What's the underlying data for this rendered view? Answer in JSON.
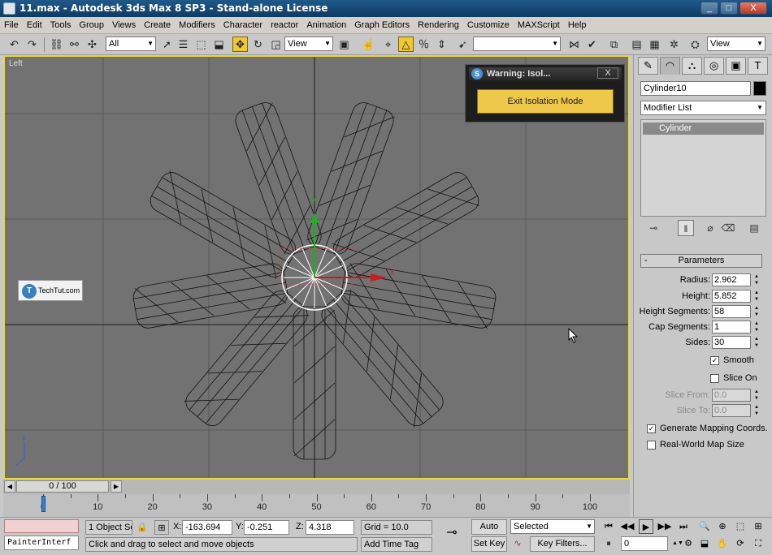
{
  "window": {
    "title": "11.max - Autodesk 3ds Max 8 SP3 - Stand-alone License",
    "controls": [
      "_",
      "□",
      "X"
    ]
  },
  "menu": [
    "File",
    "Edit",
    "Tools",
    "Group",
    "Views",
    "Create",
    "Modifiers",
    "Character",
    "reactor",
    "Animation",
    "Graph Editors",
    "Rendering",
    "Customize",
    "MAXScript",
    "Help"
  ],
  "toolbar": {
    "selection_filter": "All",
    "ref_coord": "View",
    "named_selection": "",
    "view_right": "View",
    "icons": [
      "undo-icon",
      "redo-icon",
      "link-icon",
      "unlink-icon",
      "bind-space-warp-icon",
      "select-icon",
      "select-by-name-icon",
      "rect-region-icon",
      "window-crossing-icon",
      "move-icon",
      "rotate-icon",
      "scale-icon",
      "pivot-icon",
      "manipulate-icon",
      "snap-icon",
      "angle-snap-icon",
      "percent-snap-icon",
      "spinner-snap-icon",
      "mirror-icon",
      "align-icon",
      "layer-icon",
      "curve-editor-icon",
      "schematic-icon",
      "material-editor-icon",
      "render-scene-icon",
      "quick-render-icon"
    ]
  },
  "viewport": {
    "label": "Left",
    "watermark": "TechTut.com",
    "axis_labels": {
      "x": "x",
      "y": "y",
      "z": "z"
    },
    "accent": "#e8d840"
  },
  "warning": {
    "title": "Warning: Isol...",
    "close": "X",
    "button": "Exit Isolation Mode"
  },
  "panel": {
    "tabs": [
      "create-icon",
      "modify-icon",
      "hierarchy-icon",
      "motion-icon",
      "display-icon",
      "utilities-icon"
    ],
    "object_name": "Cylinder10",
    "modifier_list": "Modifier List",
    "stack": [
      "Cylinder"
    ],
    "parameters_title": "Parameters",
    "parameters_collapse": "-",
    "params": [
      {
        "label": "Radius:",
        "value": "2.962"
      },
      {
        "label": "Height:",
        "value": "5.852"
      },
      {
        "label": "Height Segments:",
        "value": "58"
      },
      {
        "label": "Cap Segments:",
        "value": "1"
      },
      {
        "label": "Sides:",
        "value": "30"
      }
    ],
    "smooth": {
      "label": "Smooth",
      "checked": true
    },
    "slice_on": {
      "label": "Slice On",
      "checked": false
    },
    "slice_from": {
      "label": "Slice From:",
      "value": "0.0"
    },
    "slice_to": {
      "label": "Slice To:",
      "value": "0.0"
    },
    "gen_mapping": {
      "label": "Generate Mapping Coords.",
      "checked": true
    },
    "real_world": {
      "label": "Real-World Map Size",
      "checked": false
    }
  },
  "timeline": {
    "slider_text": "0 / 100",
    "ticks": [
      "0",
      "10",
      "20",
      "30",
      "40",
      "50",
      "60",
      "70",
      "80",
      "90",
      "100"
    ]
  },
  "status": {
    "maxscript": "PainterInterf",
    "selection": "1 Object Se",
    "x_label": "X:",
    "x": "-163.694",
    "y_label": "Y:",
    "y": "-0.251",
    "z_label": "Z:",
    "z": "4.318",
    "grid": "Grid = 10.0",
    "prompt": "Click and drag to select and move objects",
    "add_time_tag": "Add Time Tag",
    "auto_key": "Auto Key",
    "set_key": "Set Key",
    "key_mode": "Selected",
    "key_filters": "Key Filters...",
    "frame": "0"
  }
}
